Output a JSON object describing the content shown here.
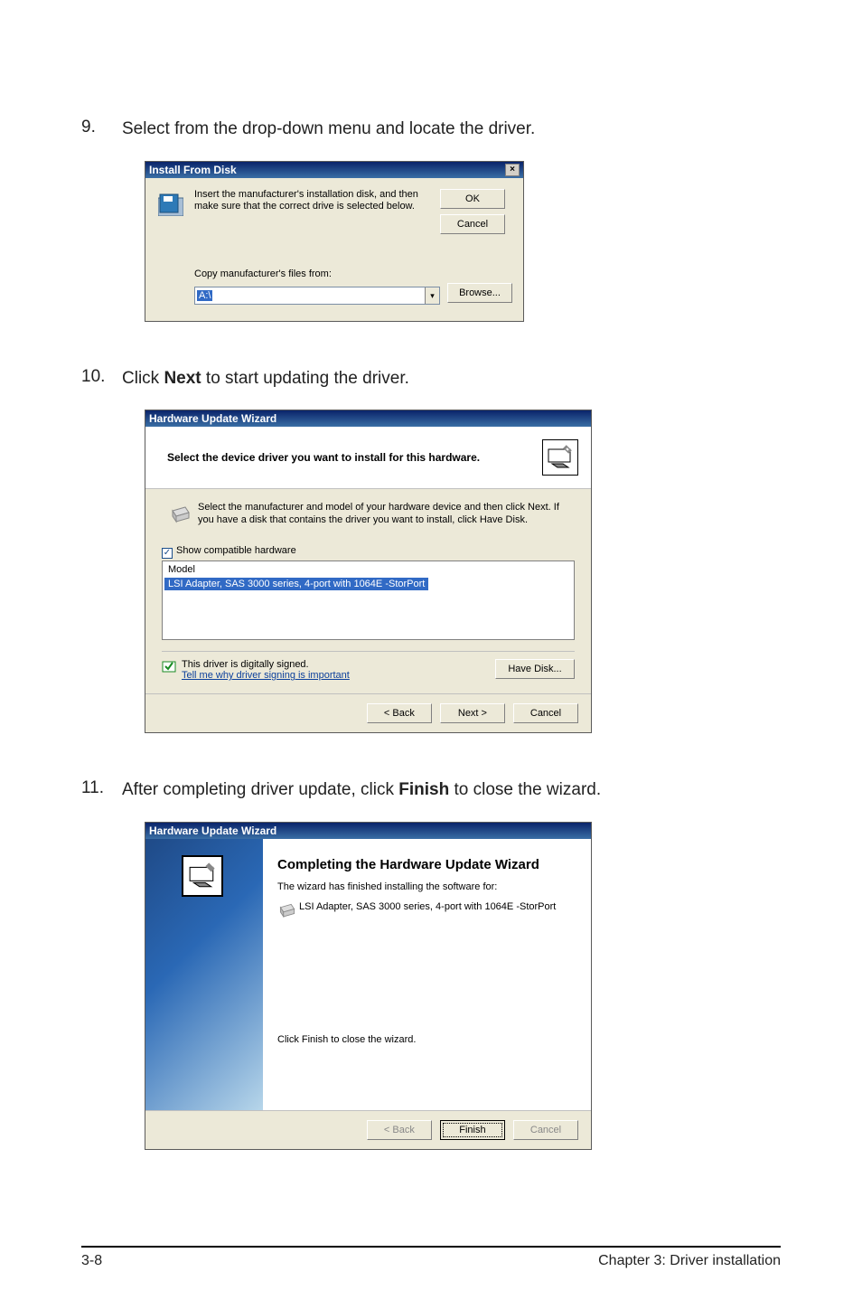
{
  "steps": {
    "s9": {
      "num": "9.",
      "text_pre": "Select from the drop-down menu and locate the driver."
    },
    "s10": {
      "num": "10.",
      "text_a": "Click ",
      "text_bold": "Next",
      "text_b": " to start updating the driver."
    },
    "s11": {
      "num": "11.",
      "text_a": "After completing driver update, click ",
      "text_bold": "Finish",
      "text_b": " to close the wizard."
    }
  },
  "dlg1": {
    "title": "Install From Disk",
    "close": "×",
    "msg": "Insert the manufacturer's installation disk, and then make sure that the correct drive is selected below.",
    "ok": "OK",
    "cancel": "Cancel",
    "copy_label": "Copy manufacturer's files from:",
    "path": "A:\\",
    "dd": "▾",
    "browse": "Browse..."
  },
  "dlg2": {
    "title": "Hardware Update Wizard",
    "heading": "Select the device driver you want to install for this hardware.",
    "info": "Select the manufacturer and model of your hardware device and then click Next. If you have a disk that contains the driver you want to install, click Have Disk.",
    "check": "✓",
    "show_compat": "Show compatible hardware",
    "model_hdr": "Model",
    "model_item": "LSI Adapter, SAS 3000 series, 4-port with 1064E -StorPort",
    "signed": "This driver is digitally signed.",
    "signed_link": "Tell me why driver signing is important",
    "have_disk": "Have Disk...",
    "back": "< Back",
    "next": "Next >",
    "cancel": "Cancel"
  },
  "dlg3": {
    "title": "Hardware Update Wizard",
    "heading": "Completing the Hardware Update Wizard",
    "line1": "The wizard has finished installing the software for:",
    "device": "LSI Adapter, SAS 3000 series, 4-port with 1064E -StorPort",
    "line2": "Click Finish to close the wizard.",
    "back": "< Back",
    "finish": "Finish",
    "cancel": "Cancel"
  },
  "footer": {
    "left": "3-8",
    "right": "Chapter 3: Driver installation"
  }
}
